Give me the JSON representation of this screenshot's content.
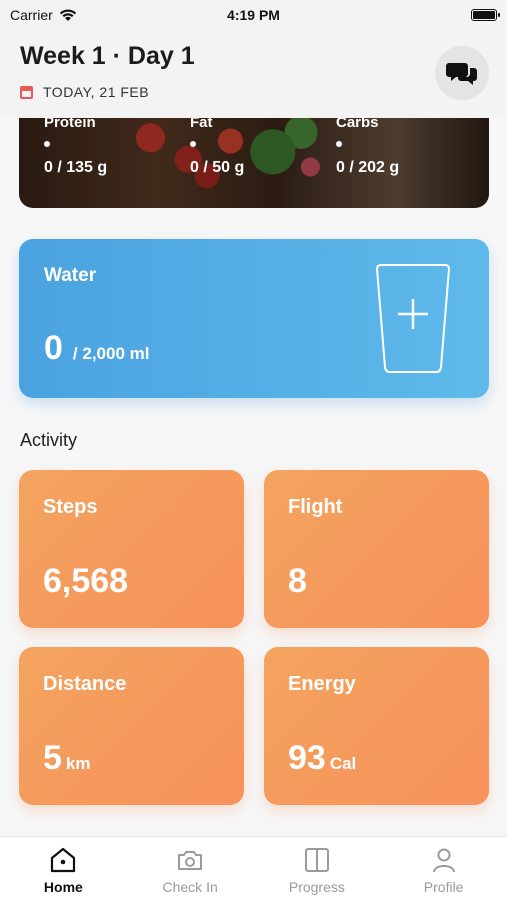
{
  "status": {
    "carrier": "Carrier",
    "time": "4:19 PM"
  },
  "header": {
    "title": "Week 1 · Day 1",
    "date": "TODAY, 21 FEB"
  },
  "macros": [
    {
      "label": "Protein",
      "value": "0 / 135 g"
    },
    {
      "label": "Fat",
      "value": "0 / 50 g"
    },
    {
      "label": "Carbs",
      "value": "0 / 202 g"
    }
  ],
  "water": {
    "title": "Water",
    "current": "0",
    "goal": "/  2,000 ml"
  },
  "activity": {
    "title": "Activity",
    "tiles": [
      {
        "label": "Steps",
        "value": "6,568",
        "unit": ""
      },
      {
        "label": "Flight",
        "value": "8",
        "unit": ""
      },
      {
        "label": "Distance",
        "value": "5",
        "unit": "km"
      },
      {
        "label": "Energy",
        "value": "93",
        "unit": "Cal"
      }
    ]
  },
  "tabs": [
    {
      "label": "Home",
      "icon": "home-icon",
      "active": true
    },
    {
      "label": "Check In",
      "icon": "camera-icon",
      "active": false
    },
    {
      "label": "Progress",
      "icon": "book-icon",
      "active": false
    },
    {
      "label": "Profile",
      "icon": "person-icon",
      "active": false
    }
  ],
  "colors": {
    "water": "#4aa3e0",
    "activity": "#f3a45f",
    "accent_red": "#e85a5a"
  }
}
